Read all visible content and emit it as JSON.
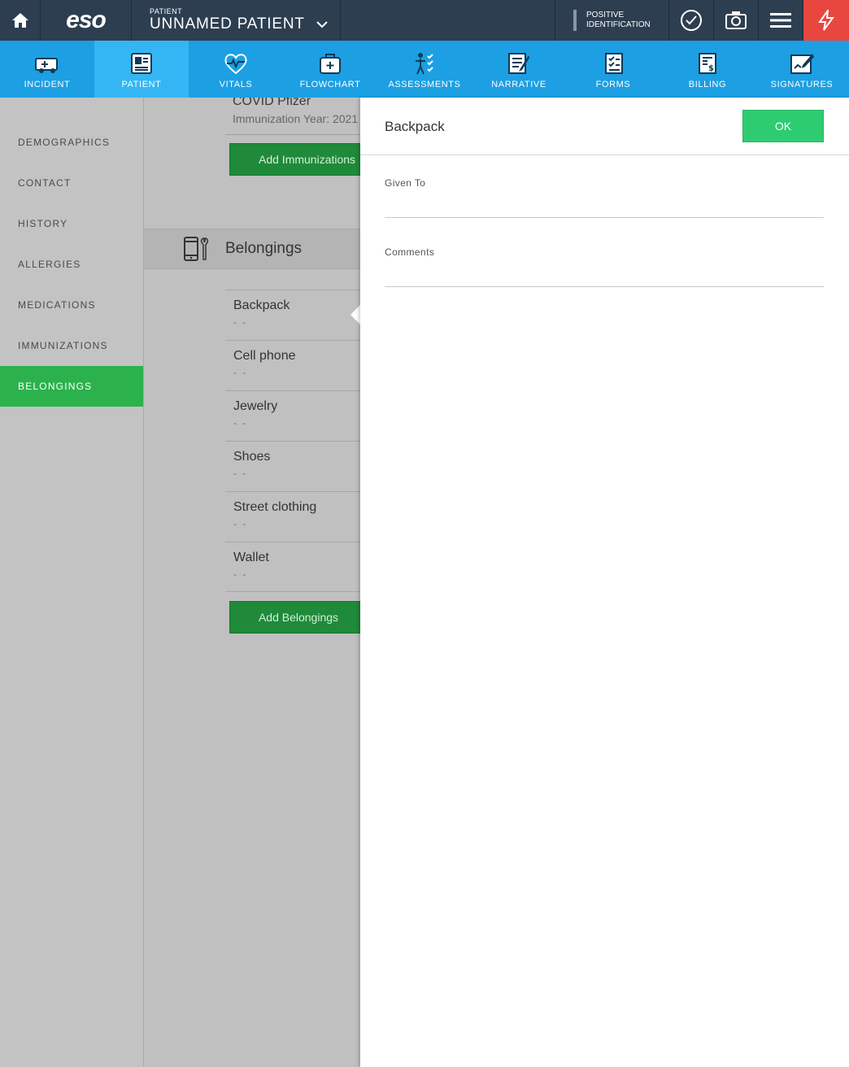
{
  "topbar": {
    "logo": "eso",
    "patient_label": "PATIENT",
    "patient_name": "UNNAMED PATIENT",
    "positive_id_line1": "POSITIVE",
    "positive_id_line2": "IDENTIFICATION"
  },
  "nav": [
    {
      "label": "INCIDENT",
      "icon": "ambulance-icon"
    },
    {
      "label": "PATIENT",
      "icon": "patient-card-icon"
    },
    {
      "label": "VITALS",
      "icon": "heart-pulse-icon"
    },
    {
      "label": "FLOWCHART",
      "icon": "medkit-icon"
    },
    {
      "label": "ASSESSMENTS",
      "icon": "body-check-icon"
    },
    {
      "label": "NARRATIVE",
      "icon": "narrative-icon"
    },
    {
      "label": "FORMS",
      "icon": "forms-icon"
    },
    {
      "label": "BILLING",
      "icon": "billing-icon"
    },
    {
      "label": "SIGNATURES",
      "icon": "signature-icon"
    }
  ],
  "sidebar": {
    "items": [
      "DEMOGRAPHICS",
      "CONTACT",
      "HISTORY",
      "ALLERGIES",
      "MEDICATIONS",
      "IMMUNIZATIONS",
      "BELONGINGS"
    ],
    "active": "BELONGINGS"
  },
  "content": {
    "covid_title": "COVID Pfizer",
    "covid_sub": "Immunization Year: 2021",
    "add_immunizations": "Add Immunizations",
    "belongings_header": "Belongings",
    "belongings": [
      {
        "name": "Backpack",
        "value": "- -"
      },
      {
        "name": "Cell phone",
        "value": "- -"
      },
      {
        "name": "Jewelry",
        "value": "- -"
      },
      {
        "name": "Shoes",
        "value": "- -"
      },
      {
        "name": "Street clothing",
        "value": "- -"
      },
      {
        "name": "Wallet",
        "value": "- -"
      }
    ],
    "add_belongings": "Add Belongings"
  },
  "panel": {
    "title": "Backpack",
    "ok_label": "OK",
    "given_to_label": "Given To",
    "given_to_value": "",
    "comments_label": "Comments",
    "comments_value": ""
  }
}
